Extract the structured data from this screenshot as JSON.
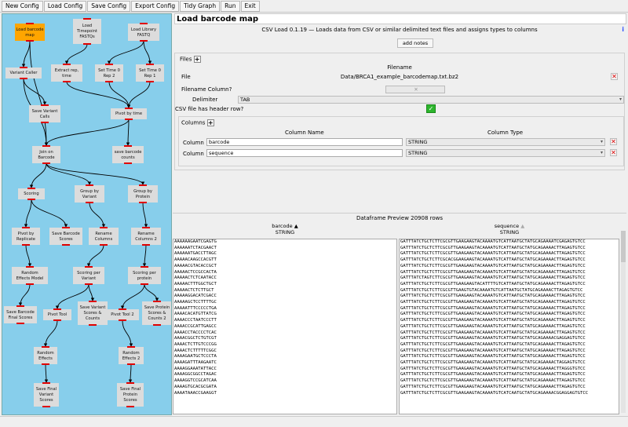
{
  "toolbar": {
    "items": [
      "New Config",
      "Load Config",
      "Save Config",
      "Export Config",
      "Tidy Graph",
      "Run",
      "Exit"
    ]
  },
  "graph": {
    "nodes": [
      {
        "id": "load_barcode_map",
        "label": "Load barcode\nmap",
        "selected": true
      },
      {
        "id": "load_timepoint_fastqs",
        "label": "Load\nTimepoint\nFASTQs"
      },
      {
        "id": "load_library_fastq",
        "label": "Load Library\nFASTQ"
      },
      {
        "id": "variant_caller",
        "label": "Variant Caller"
      },
      {
        "id": "extract_rep_time",
        "label": "Extract rep,\ntime"
      },
      {
        "id": "set_time0_rep2",
        "label": "Set Time 0\nRep 2"
      },
      {
        "id": "set_time0_rep1",
        "label": "Set Time 0\nRep 1"
      },
      {
        "id": "save_variant_calls",
        "label": "Save Variant\nCalls"
      },
      {
        "id": "pivot_by_time",
        "label": "Pivot by time"
      },
      {
        "id": "join_on_barcode",
        "label": "Join on\nBarcode"
      },
      {
        "id": "save_barcode_counts",
        "label": "save barcode\ncounts"
      },
      {
        "id": "scoring",
        "label": "Scoring"
      },
      {
        "id": "group_by_variant",
        "label": "Group by\nVariant"
      },
      {
        "id": "group_by_protein",
        "label": "Group by\nProtein"
      },
      {
        "id": "pivot_by_replicate",
        "label": "Pivot by\nReplicate"
      },
      {
        "id": "save_barcode_scores",
        "label": "Save Barcode\nScores"
      },
      {
        "id": "rename_columns",
        "label": "Rename\nColumns"
      },
      {
        "id": "rename_columns_2",
        "label": "Rename\nColumns 2"
      },
      {
        "id": "random_effects_model",
        "label": "Random\nEffects Model"
      },
      {
        "id": "scoring_per_variant",
        "label": "Scoring per\nVariant"
      },
      {
        "id": "scoring_per_protein",
        "label": "Scoring per\nprotein"
      },
      {
        "id": "save_barcode_final_scores",
        "label": "Save Barcode\nFinal Scores"
      },
      {
        "id": "pivot_tool",
        "label": "Pivot Tool"
      },
      {
        "id": "save_variant_scores_counts",
        "label": "Save Variant\nScores &\nCounts"
      },
      {
        "id": "pivot_tool_2",
        "label": "Pivot Tool 2"
      },
      {
        "id": "save_protein_scores_counts_2",
        "label": "Save Protein\nScores &\nCounts 2"
      },
      {
        "id": "random_effects",
        "label": "Random\nEffects"
      },
      {
        "id": "random_effects_2",
        "label": "Random\nEffects 2"
      },
      {
        "id": "save_final_variant_scores",
        "label": "Save Final\nVariant\nScores"
      },
      {
        "id": "save_final_protein_scores",
        "label": "Save Final\nProtein\nScores"
      }
    ]
  },
  "config": {
    "title": "Load barcode map",
    "description": "CSV Load 0.1.19 — Loads data from CSV or similar delimited text files and assigns types to columns",
    "add_notes_label": "add notes",
    "files_label": "Files",
    "filename_header": "Filename",
    "file_row_label": "File",
    "file_value": "Data/BRCA1_example_barcodemap.txt.bz2",
    "filename_column_label": "Filename Column?",
    "delimiter_label": "Delimiter",
    "delimiter_value": "TAB",
    "header_row_label": "CSV file has header row?",
    "header_row_checked": true,
    "columns_label": "Columns",
    "column_name_header": "Column Name",
    "column_type_header": "Column Type",
    "column_rows": [
      {
        "label": "Column",
        "name": "barcode",
        "type": "STRING"
      },
      {
        "label": "Column",
        "name": "sequence",
        "type": "STRING"
      }
    ]
  },
  "preview": {
    "title": "Dataframe Preview 20908 rows",
    "columns": [
      {
        "name": "barcode",
        "type": "STRING",
        "sort": "▲"
      },
      {
        "name": "sequence",
        "type": "STRING",
        "sort": "▲"
      }
    ],
    "barcodes": [
      "AAAAAAGAATCGAGTG",
      "AAAAAATCTACGAACT",
      "AAAAAATGACCTTAGC",
      "AAAAACAAGCCACGTT",
      "AAAAACGTACACCGCT",
      "AAAAACTCCGCCACTA",
      "AAAAACTCTCAATACC",
      "AAAAACTTTGGCTGCT",
      "AAAAACTCTCTTGCT",
      "AAAAAGGACATCGACC",
      "AAAAAGCTCCTTTTGC",
      "AAAAATTTCCCCCTGA",
      "AAAACACATGTTATCG",
      "AAAACCCTAATCCCTT",
      "AAAACCGCATTGAGCC",
      "AAAACCTACCCCTCAC",
      "AAAACGGCTCTGTCGT",
      "AAAACTCTTGTCCCGG",
      "AAAACTCTTTTTCGGC",
      "AAAAGAATGCTCCCTA",
      "AAAAGATTTAAGAATC",
      "AAAAGGAAATATTACC",
      "AAAAGGCGGCCTAGAC",
      "AAAAGGTCCGCATCAA",
      "AAAAGTGCACGCGATA",
      "AAAATAAACCGAAGGT"
    ],
    "sequences": [
      "GATTTATCTGCTCTTCGCGTTGAAGAAGTACAAAATGTCATTAATGCTATGCAGAAAATCGAGAGTGTCC",
      "GATTTATCTGCTCTTCGCGTTGAAGAAGTACAAAATGTCATTAATGCTATGCAGAAAACTTAGAGTGTCC",
      "GATTTATCTGCTCTTCGCGTTGAAGAAGTACAAAATGTCATTAATGCTATGCAGAAAACTTAGAGTGTCC",
      "GATTTATCTGCTCTTCGCACGGAAGAAGTACAAAATGTCATTAATGCTATGCAGAAAACTTAGAGTGTCC",
      "GATTTATCTGCTCTTCGCGTTGAAGAAGTACAAAATGTCATTAATGCTATGCAGAAAACTTAGAGTGTCC",
      "GATTTATCTGCTCTTCGCGTTGAAGAAGTACAAAATGTCATTAATGCTATGCAGAAAACTTAGAGTGTCC",
      "GATTTATCTAGTCTTCGCGTTGAAGAAGTACAAAATGTCATTAATGCTATGCAGAAAACTTAGAGTGTCC",
      "GATTTATCTGCTCTTCGCGTTGAAGAAGTACATTTTGTCATTAATGCTATGCAGAAAACTTAGAGTGTCC",
      "GATTTATCTGCTCTTCGCGTTGAAGTGTACAAAATGTCATTAATGCTATGCAGAAAACTTAGAGTGTCC",
      "GATTTATCTGCTCTTCGCGTTGAAGAAGTACAAAATGTCATTAATGCTATGCAGAAAACTTAGAGTGTCC",
      "GATTTATCTGCTCTTCGCGTTGAAGAAGTACAAAATGTCATTAATGCTATGCAGAAAACTTAGAGTGTCC",
      "GATTTATCTGCTCTTCGCGTTGAAGAAGTACAAAATGTCATTAATGCTATGCAGAAAACTTAGAGTGTCC",
      "GATTTATCTGCTCTTCGCGTTGAAGAAGTACAAAATGTCATTAATGCTATGCAGAAAACTTAGAGTGTCC",
      "GATTTATCTGCTCTTCGCGTTGAAGAAGTACAAAATGTCATTAATGCTATGCAGAAAACTTAGAGTGTCC",
      "GATTTATCTGCTCTTCGCGTTGAAGAAGTACAAAATGTCATTAATGCTATGCAGAAAACTTAGAGTGTCC",
      "GATTTATCTGCTCTTCGCGTTGAAGAAGTACAAAATGTCATTAATGCTATGCAGAAAACTTAGAGTGTCC",
      "GATTTATCTGCTCTTCGCGTTGAAGAAGTACAAAATGTCATTAATGCTATGCAGAAAACGAGGAGTGTCC",
      "GATTTATCTGCTCTTCGCGTTGAAGAAGTACAAAATGTCATTAATGCTATGCAGAAAACTTAGAGTGTCC",
      "GATTTATCTGCTCTTCGCGTTGAAGAAGTACAAAATGTCATTAATGCTATGCAGAAAACTTAGAGTGTCC",
      "GATTTATCTGCTCTTCGCGTTGAAGAAGTACAAAATGTCATTAATGCTATGCAGAAAACTTAGAGTGTCC",
      "GATTTATCTGCTCTTCGCGTTGAAGAAGTACAAAATGTCATTAATGCTATGCAGAAAACTAGGAGTGTCC",
      "GATTTATCTGCTCTTCGCGTTGAAGAAGTACAAAATGTCATTAATGCTATGCAGAAAACTTAGGGTGTCC",
      "GATTTATCTGCTCTTCGCGTTGAAGAAGTACAAAATGTCATTAATGCTATGCAGAAAACTTAGAGTGTCC",
      "GATTTATCTGCTCTTCGCGTTGAAGAAGTACAAAATGTCATTAATGCTATGCAGAAAACTTAGAGTGTCC",
      "GATTTATCTGCTCTTCGCGTTGAAGAAGTACAAAATGTCATTAATGCTATGCAGAAAACTTAGAGTGTCC",
      "GATTTATCTGCTCTTCGCGTTGAAGAAGTACAAAATGTCATCAATGCTATGCAGAAAACGGAGGAGTGTCC"
    ]
  }
}
